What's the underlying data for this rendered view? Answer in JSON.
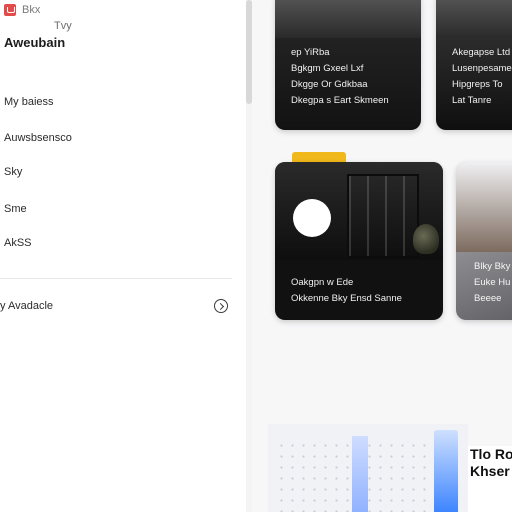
{
  "sidebar": {
    "top_labels": [
      "Bkx",
      "Tvy"
    ],
    "title": "Aweubain",
    "items": [
      "My baiess",
      "Auwsbsensco",
      "Sky",
      "Sme",
      "AkSS"
    ],
    "footer": {
      "label": "y Avadacle",
      "button_icon": "chevron-right-circle-icon"
    }
  },
  "cards": {
    "a": {
      "lines": [
        "ep     YiRba",
        "Bgkgm Gxeel Lxf",
        "Dkgge Or Gdkbaa",
        "Dkegpa s Eart Skmeen"
      ]
    },
    "b": {
      "lines": [
        "Akegapse Ltd",
        "Lusenpesamean",
        "Hipgreps To",
        "Lat Tanre"
      ]
    },
    "c": {
      "lines": [
        "Oakgpn w Ede",
        "Okkenne Bky Ensd Sanne"
      ]
    },
    "d": {
      "lines": [
        "Blky Bky",
        "Euke Hu",
        "Beeee"
      ]
    }
  },
  "bottom": {
    "title_line1": "Tlo Ro",
    "title_line2": "Khser"
  },
  "colors": {
    "accent_yellow": "#f0b81a",
    "app_icon": "#e34b4b",
    "chart_blue": "#2f7cff"
  }
}
